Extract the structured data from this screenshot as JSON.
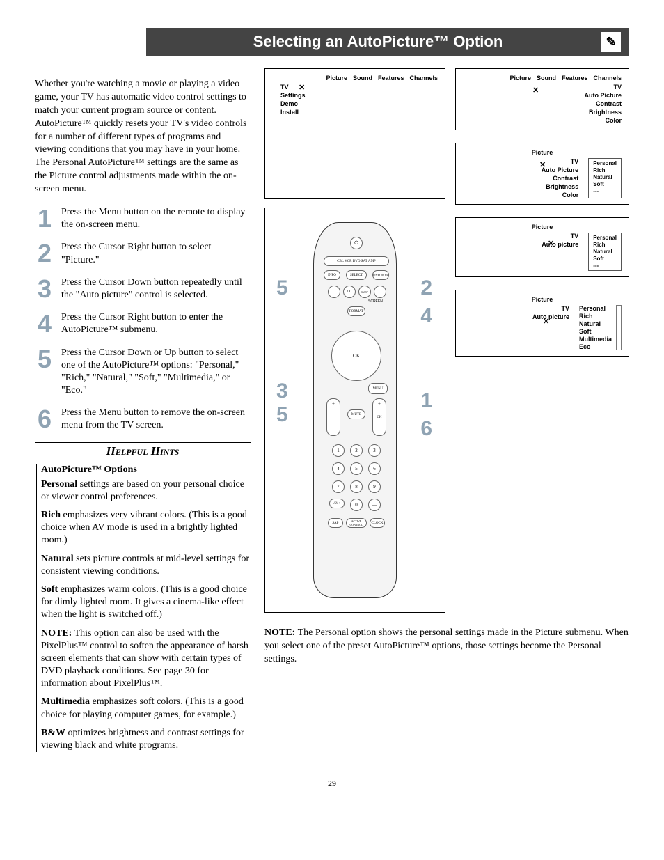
{
  "title": "Selecting an AutoPicture™ Option",
  "intro": "Whether you're watching a movie or playing a video game, your TV has automatic video control settings to match your current program source or content. AutoPicture™ quickly resets your TV's video controls for a number of different types of programs and viewing conditions that you may have in your home.  The Personal AutoPicture™ settings are the same as the Picture control adjustments made within the on-screen menu.",
  "steps": [
    {
      "n": "1",
      "t": "Press the Menu button on the remote to display the on-screen menu."
    },
    {
      "n": "2",
      "t": "Press the Cursor Right button to select \"Picture.\""
    },
    {
      "n": "3",
      "t": "Press the Cursor Down button repeatedly until the \"Auto picture\" control is selected."
    },
    {
      "n": "4",
      "t": "Press the Cursor Right button to enter the AutoPicture™ submenu."
    },
    {
      "n": "5",
      "t": "Press the Cursor Down or Up button to select one of the AutoPicture™ options: \"Personal,\" \"Rich,\" \"Natural,\" \"Soft,\" \"Multimedia,\" or \"Eco.\""
    },
    {
      "n": "6",
      "t": "Press the Menu button to remove the on-screen menu from the TV screen."
    }
  ],
  "hints_title": "Helpful Hints",
  "hints_sub": "AutoPicture™ Options",
  "hints": [
    {
      "lead": "Personal",
      "rest": " settings are based on your personal choice or viewer control preferences."
    },
    {
      "lead": "Rich",
      "rest": " emphasizes very vibrant colors. (This is a good choice when AV mode is used in a brightly lighted room.)"
    },
    {
      "lead": "Natural",
      "rest": " sets picture controls at mid-level settings for consistent viewing conditions."
    },
    {
      "lead": "Soft",
      "rest": " emphasizes warm colors. (This is a good choice for dimly lighted room. It gives a cinema-like effect when the light is switched off.)"
    },
    {
      "lead": "NOTE:",
      "rest": " This option can also be used with the PixelPlus™ control to soften the appearance of harsh screen elements that can show with certain types of DVD playback conditions. See page 30 for information about PixelPlus™."
    },
    {
      "lead": "Multimedia",
      "rest": " emphasizes soft colors. (This is a good choice for playing computer games, for example.)"
    },
    {
      "lead": "B&W",
      "rest": " optimizes  brightness and contrast settings for viewing black and white programs."
    }
  ],
  "menus": {
    "top_tabs": [
      "Picture",
      "Sound",
      "Features",
      "Channels"
    ],
    "side1": [
      "TV",
      "Settings",
      "Demo",
      "Install"
    ],
    "pane2_side": [
      "TV",
      "Auto Picture",
      "Contrast",
      "Brightness",
      "Color"
    ],
    "pane2_header": "Picture",
    "pane3_side": [
      "TV",
      "Auto Picture",
      "Contrast",
      "Brightness",
      "Color"
    ],
    "pane3_opts": [
      "Personal",
      "Rich",
      "Natural",
      "Soft",
      "---"
    ],
    "pane4_side": [
      "TV",
      "Auto picture"
    ],
    "pane4_opts": [
      "Personal",
      "Rich",
      "Natural",
      "Soft",
      "---"
    ],
    "pane5_side": [
      "TV",
      "Auto picture"
    ],
    "pane5_opts": [
      "Personal",
      "Rich",
      "Natural",
      "Soft",
      "Multimedia",
      "Eco"
    ]
  },
  "remote": {
    "dev_row": [
      "CBL",
      "VCR",
      "DVD",
      "SAT",
      "AMP"
    ],
    "row2": [
      "INFO",
      "SELECT",
      "PIXEL PLUS"
    ],
    "row3_labels": [
      "CC",
      "SURF"
    ],
    "screen_label": "SCREEN",
    "format_label": "FORMAT",
    "ok": "OK",
    "menu": "MENU",
    "mute": "MUTE",
    "ch": "CH",
    "numpad": [
      "1",
      "2",
      "3",
      "4",
      "5",
      "6",
      "7",
      "8",
      "9",
      "AV+",
      "0",
      "—"
    ],
    "bottom": [
      "SAP",
      "ACTIVE CONTROL",
      "CLOCK"
    ]
  },
  "callouts": [
    "5",
    "2",
    "4",
    "3",
    "5",
    "1",
    "6"
  ],
  "bottom_note_lead": "NOTE:",
  "bottom_note": " The Personal option shows the personal settings made in the Picture submenu. When you select one of the preset AutoPicture™ options, those settings become the Personal settings.",
  "page_num": "29"
}
